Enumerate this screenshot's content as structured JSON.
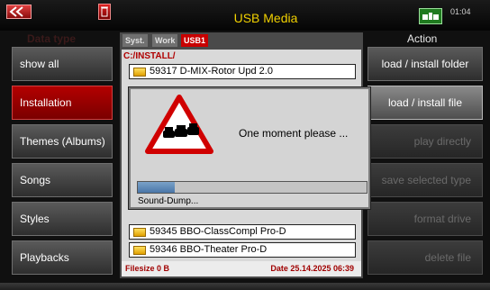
{
  "header": {
    "title": "USB Media",
    "time": "01:04",
    "usb_icon": "usb-device-icon"
  },
  "left": {
    "header": "Data type",
    "items": [
      "show all",
      "Installation",
      "Themes (Albums)",
      "Songs",
      "Styles",
      "Playbacks"
    ],
    "active_index": 1
  },
  "right": {
    "header": "Action",
    "items": [
      "load / install folder",
      "load / install file",
      "play directly",
      "save selected type",
      "format drive",
      "delete file"
    ]
  },
  "middle": {
    "tabs": [
      "Syst.",
      "Work",
      "USB1"
    ],
    "active_tab": "USB1",
    "path": "C:/INSTALL/",
    "files": [
      "59317 D-MIX-Rotor Upd 2.0",
      "59345 BBO-ClassCompl Pro-D",
      "59346 BBO-Theater Pro-D"
    ],
    "filesize": "Filesize 0 B",
    "date": "Date 25.14.2025 06:39"
  },
  "dialog": {
    "message": "One moment please ...",
    "status": "Sound-Dump...",
    "progress": 0.16,
    "icon": "traffic-jam-warning-icon"
  },
  "colors": {
    "accent_red": "#c80000",
    "title_yellow": "#f0d000",
    "file_text": "#000000"
  }
}
